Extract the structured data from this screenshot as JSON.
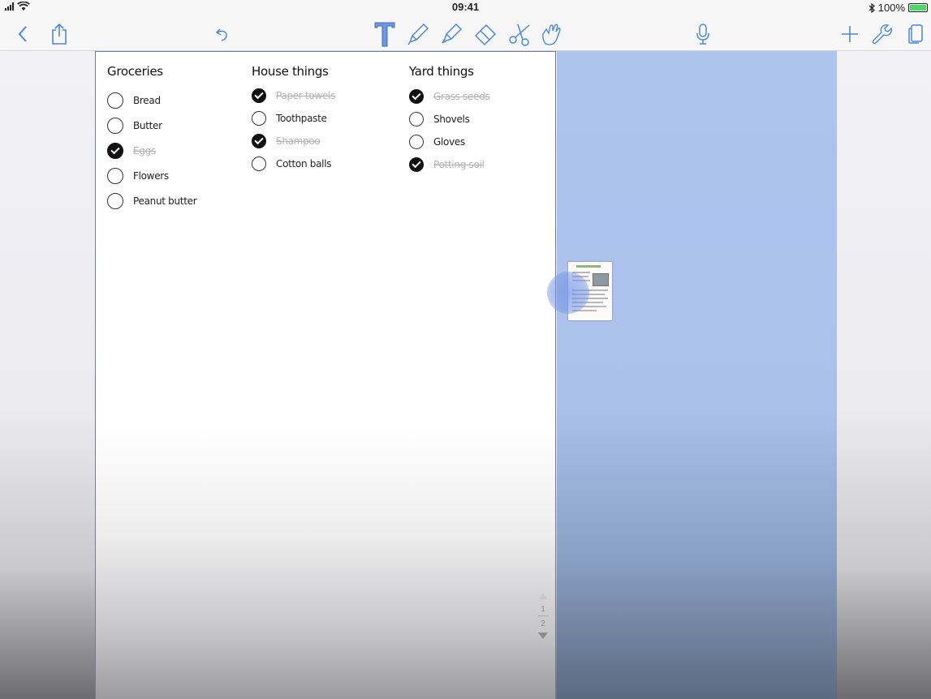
{
  "status_bar": {
    "time": "09:41",
    "battery_percent": "100%",
    "wifi_icon": "wifi-icon",
    "bluetooth_icon": "bluetooth-icon"
  },
  "toolbar": {
    "left_icons": [
      "back-icon",
      "share-icon",
      "undo-icon"
    ],
    "tool_icons": [
      "text-tool-icon",
      "pen-icon",
      "highlighter-icon",
      "eraser-icon",
      "scissors-icon",
      "hand-pointer-icon"
    ],
    "right_icons": [
      "microphone-icon",
      "add-icon",
      "wrench-icon",
      "pages-icon"
    ],
    "active_tool": "text-tool-icon",
    "accent_color": "#4a89dc"
  },
  "lists": [
    {
      "title": "Groceries",
      "items": [
        {
          "label": "Bread",
          "checked": false
        },
        {
          "label": "Butter",
          "checked": false
        },
        {
          "label": "Eggs",
          "checked": true
        },
        {
          "label": "Flowers",
          "checked": false
        },
        {
          "label": "Peanut butter",
          "checked": false
        }
      ]
    },
    {
      "title": "House things",
      "items": [
        {
          "label": "Paper towels",
          "checked": true
        },
        {
          "label": "Toothpaste",
          "checked": false
        },
        {
          "label": "Shampoo",
          "checked": true
        },
        {
          "label": "Cotton balls",
          "checked": false
        }
      ]
    },
    {
      "title": "Yard things",
      "items": [
        {
          "label": "Grass seeds",
          "checked": true
        },
        {
          "label": "Shovels",
          "checked": false
        },
        {
          "label": "Gloves",
          "checked": false
        },
        {
          "label": "Potting soil",
          "checked": true
        }
      ]
    }
  ],
  "pager": {
    "current_page": "1",
    "total_pages": "2"
  },
  "colors": {
    "selection_area": "#aec4ef",
    "checked_text": "#b3b3b3"
  }
}
